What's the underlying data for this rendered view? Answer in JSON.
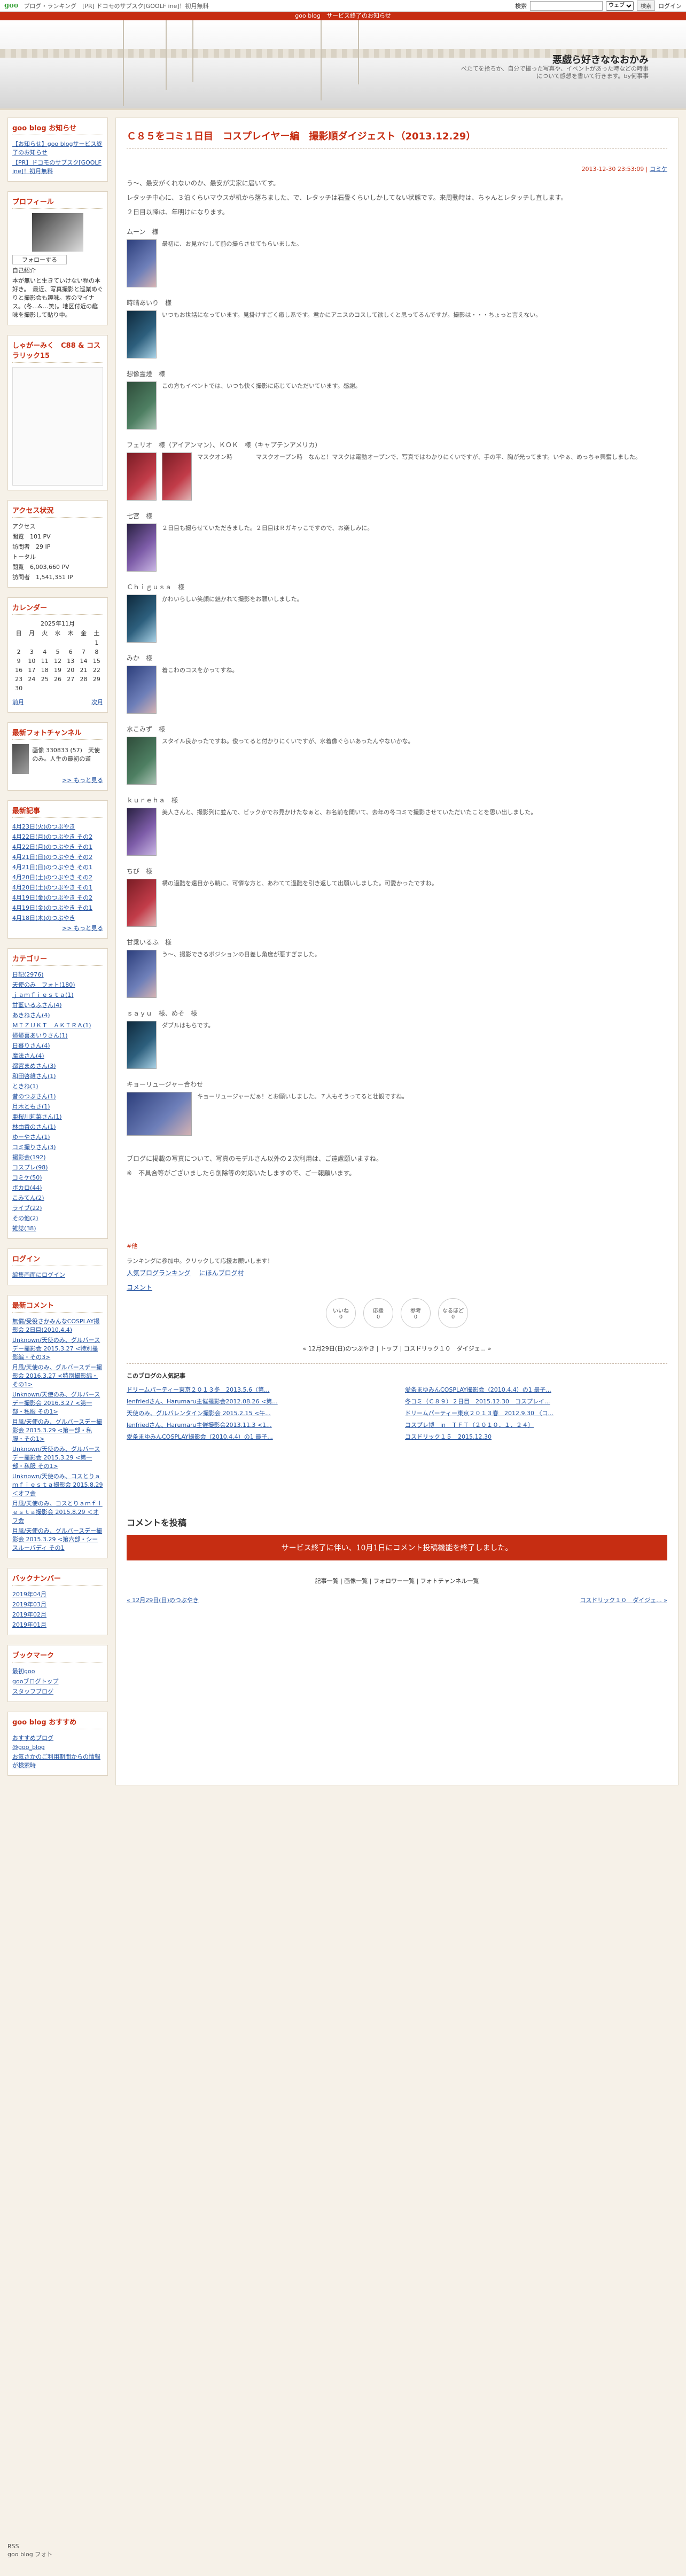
{
  "topbar": {
    "logo": "goo",
    "links": "ブログ・ランキング　[PR] ドコモのサブスク[GOOLF ine]！初月無料",
    "search_label": "検索",
    "search_value": "",
    "search_option": "ウェブ",
    "go_button": "検索",
    "login": "ログイン"
  },
  "notice": "goo blog　サービス終了のお知らせ",
  "header": {
    "title": "悪戯ら好きななおかみ",
    "description": "べたてを拾ろか、自分で撮った写真や、イベントがあった時などの時事について感想を書いて行きます。by何事事"
  },
  "sidebar": {
    "notice_title": "goo blog お知らせ",
    "notice_items": [
      "【お知らせ】goo blogサービス終了のお知らせ",
      "【PR】ドコモのサブスク[GOOLF ine]！初月無料"
    ],
    "profile_title": "プロフィール",
    "profile_follow": "フォローする",
    "profile_name": "自己紹介",
    "profile_text": "本が無いと生きていけない程の本好き。　最近、写真撮影と巡業めぐりと撮影会も趣味。素のマイナス。(冬…&…笑)。地区付近の趣味を撮影して貼り中。",
    "ranking_title": "しゃがーみく　C88 & コスラリック15",
    "access_title": "アクセス状況",
    "access_today_label": "アクセス",
    "access_rows": [
      [
        "閲覧",
        "101 PV"
      ],
      [
        "訪問者",
        "29 IP"
      ]
    ],
    "total_label": "トータル",
    "total_rows": [
      [
        "閲覧",
        "6,003,660 PV"
      ],
      [
        "訪問者",
        "1,541,351 IP"
      ]
    ],
    "calendar_title": "カレンダー",
    "calendar_month": "2025年11月",
    "calendar_days": [
      "日",
      "月",
      "火",
      "水",
      "木",
      "金",
      "土"
    ],
    "calendar_weeks": [
      [
        "",
        "",
        "",
        "",
        "",
        "",
        "1"
      ],
      [
        "2",
        "3",
        "4",
        "5",
        "6",
        "7",
        "8"
      ],
      [
        "9",
        "10",
        "11",
        "12",
        "13",
        "14",
        "15"
      ],
      [
        "16",
        "17",
        "18",
        "19",
        "20",
        "21",
        "22"
      ],
      [
        "23",
        "24",
        "25",
        "26",
        "27",
        "28",
        "29"
      ],
      [
        "30",
        "",
        "",
        "",
        "",
        "",
        ""
      ]
    ],
    "calendar_prev": "前月",
    "calendar_next": "次月",
    "photo_channel_title": "最新フォトチャンネル",
    "photo_channel_text": "画像 330833 (57)　天使のみ。人生の最初の道",
    "more_link": ">> もっと見る",
    "recent_title": "最新記事",
    "recent_items": [
      "4月23日(火)のつぶやき",
      "4月22日(月)のつぶやき その2",
      "4月22日(月)のつぶやき その1",
      "4月21日(日)のつぶやき その2",
      "4月21日(日)のつぶやき その1",
      "4月20日(土)のつぶやき その2",
      "4月20日(土)のつぶやき その1",
      "4月19日(金)のつぶやき その2",
      "4月19日(金)のつぶやき その1",
      "4月18日(木)のつぶやき"
    ],
    "category_title": "カテゴリー",
    "categories": [
      "日記(2976)",
      "天使のみ　フォト(180)",
      "ｊａｍｆｉｅｓｔａ(1)",
      "甘藍いるふさん(4)",
      "あきねさん(4)",
      "ＭＩＺＵＫＴ　ＡＫＩＲＡ(1)",
      "帰帰喜あいりさん(1)",
      "日暮りさん(4)",
      "魔法さん(4)",
      "都宮まめさん(3)",
      "和田啓維さん(1)",
      "ときね(1)",
      "昔のつぶさん(1)",
      "月木ともさ(1)",
      "亜桜川莉菜さん(1)",
      "林由香のさん(1)",
      "ゆーやさん(1)",
      "コミ撮りさん(3)",
      "撮影会(192)",
      "コスプレ(98)",
      "コミケ(50)",
      "ボカロ(44)",
      "こみてん(2)",
      "ライブ(22)",
      "その他(2)",
      "雑誌(38)"
    ],
    "login_title": "ログイン",
    "login_link": "編集画面にログイン",
    "comments_title": "最新コメント",
    "comments": [
      "無償/受役さかみんなCOSPLAY撮影会 2日目(2010.4.4)",
      "Unknown/天使のみ、グルバースデー撮影会 2015.3.27 <特別撮影編・その3>",
      "月風/天使のみ、グルバースデー撮影会 2016.3.27 <特別撮影編・その1>",
      "Unknown/天使のみ、グルバースデー撮影会 2016.3.27 <第一部・私服 その1>",
      "月風/天使のみ、グルバースデー撮影会 2015.3.29 <第一部・私服・その1>",
      "Unknown/天使のみ、グルバースデー撮影会 2015.3.29 <第一部・私服 その1>",
      "Unknown/天使のみ、コスとりａｍｆｉｅｓｔａ撮影会 2015.8.29 ＜オフ会",
      "月風/天使のみ、コスとりａｍｆｉｅｓｔａ撮影会 2015.8.29 ＜オフ会",
      "月風/天使のみ、グルバースデー撮影会 2015.3.29 <第六部・シースルーバディ その1"
    ],
    "backnumber_title": "バックナンバー",
    "backnumbers": [
      "2019年04月",
      "2019年03月",
      "2019年02月",
      "2019年01月"
    ],
    "bookmark_title": "ブックマーク",
    "bookmarks": [
      "最初goo",
      "gooブログトップ",
      "スタッフブログ"
    ],
    "recommend_title": "goo blog おすすめ",
    "recommend_items": [
      "おすすめブログ",
      "@goo_blog",
      "お気さかのご利用期間からの情報が検索時"
    ],
    "footer": "RSS",
    "footer2": "goo blog フォト"
  },
  "post": {
    "title": "Ｃ８５をコミ１日目　コスプレイヤー編　撮影順ダイジェスト（2013.12.29）",
    "date": "2013-12-30 23:53:09",
    "category": "コミケ",
    "intro1": "う〜、最安がくれないのか、最安が実家に届いてす。",
    "intro2": "レタッチ中心に、３泊くらいマウスが机から落ちました、で、レタッチは石畳くらいしかしてない状態です。来周動時は、ちゃんとレタッチし直します。",
    "intro3": "２日目以降は、年明けになります。",
    "entries": [
      {
        "name": "ムーン　様",
        "caption": "最初に、お見かけして前の撮らさせてもらいました。"
      },
      {
        "name": "時晴あいり　様",
        "caption": "いつもお世話になっています。見掛けすごく癒し系です。君かにアニスのコスして欲しくと思ってるんですが。撮影は・・・ちょっと言えない。"
      },
      {
        "name": "想像霊燈　様",
        "caption": "この方もイベントでは、いつも快く撮影に応じていただいています。感謝。"
      },
      {
        "name": "フェリオ　様（アイアンマン）、ＫＯＫ　様（キャプテンアメリカ）",
        "caption": "マスクオン時　　　　マスクオープン時　なんと！マスクは電動オープンで、写真ではわかりにくいですが、手の平、胸が光ってます。いやぁ、めっちゃ興奮しました。"
      },
      {
        "name": "七宮　様",
        "caption": "２日目も撮らせていただきました。２日目はＲガキッこですので、お楽しみに。"
      },
      {
        "name": "Ｃｈｉｇｕｓａ　様",
        "caption": "かわいらしい笑顔に魅かれて撮影をお願いしました。"
      },
      {
        "name": "みか　様",
        "caption": "着こわのコスをかってすね。"
      },
      {
        "name": "水こみず　様",
        "caption": "スタイル良かったですね。俊ってると付かりにくいですが、水着像ぐらいあったんやないかな。"
      },
      {
        "name": "ｋｕｒｅｈａ　様",
        "caption": "美人さんと、撮影列に並んで、ビックかでお見かけたなぁと、お名前を聞いて、去年の冬コミで撮影させていただいたことを思い出しました。"
      },
      {
        "name": "ちび　様",
        "caption": "構の過酷を遠目から眺に、可憐な方と、あわてて過酷を引き返して出願いしました。可愛かったですね。"
      },
      {
        "name": "甘乗いるふ　様",
        "caption": "う〜、撮影できるポジションの日差し角度が悪すぎました。"
      },
      {
        "name": "ｓａｙｕ　様、めそ　様",
        "caption": "ダブルはもらです。"
      },
      {
        "name": "キョーリュージャー合わせ",
        "caption": "キョーリュージャーだぁ！とお願いしました。７人もそうってると壮観ですね。"
      }
    ],
    "outro1": "ブログに掲載の写真について、写真のモデルさん以外の２次利用は、ご遠慮願いますね。",
    "outro2": "※　不具合等がございましたら削除等の対応いたしますので、ご一報願います。",
    "tag_label": "#他",
    "ranking_text": "ランキングに参加中。クリックして応援お願いします！",
    "ranking_links": [
      "人気ブログランキング",
      "にほんブログ村"
    ],
    "comment_link": "コメント",
    "buttons": [
      [
        "いいね",
        "0"
      ],
      [
        "応援",
        "0"
      ],
      [
        "参考",
        "0"
      ],
      [
        "なるほど",
        "0"
      ]
    ],
    "prev_next": "« 12月29日(日)のつぶやき | トップ | コスドリック１０　ダイジェ... »",
    "popular_title": "このブログの人気記事",
    "popular": [
      "ドリームパーティー東京２０１３冬　2013.5.6（第...",
      "愛条まゆみんCOSPLAY撮影会（2010.4.4）の1 最子...",
      "lenfriedさん、Harumaru主催撮影会2012.08.26 <第...",
      "冬コミ（Ｃ８９）２日目　2015.12.30　コスプレイ...",
      "天使のみ、グルバレンタイン撮影会 2015.2.15 <午...",
      "ドリームパーティー東京２０１３春　2012.9.30 〈コ...",
      "lenfriedさん、Harumaru主催撮影会2013.11.3 <1...",
      "コスプレ博　in　ＴＦＴ（２０１０．１．２４）",
      "愛条まゆみんCOSPLAY撮影会（2010.4.4）の1 最子...",
      "コスドリック１５　2015.12.30"
    ],
    "comment_heading": "コメントを投稿",
    "comment_notice": "サービス終了に伴い、10月1日にコメント投稿機能を終了しました。",
    "footer_links": "記事一覧 | 画像一覧 | フォロワー一覧 | フォトチャンネル一覧",
    "nav_prev": "« 12月29日(日)のつぶやき",
    "nav_next": "コスドリック１０　ダイジェ... »"
  }
}
